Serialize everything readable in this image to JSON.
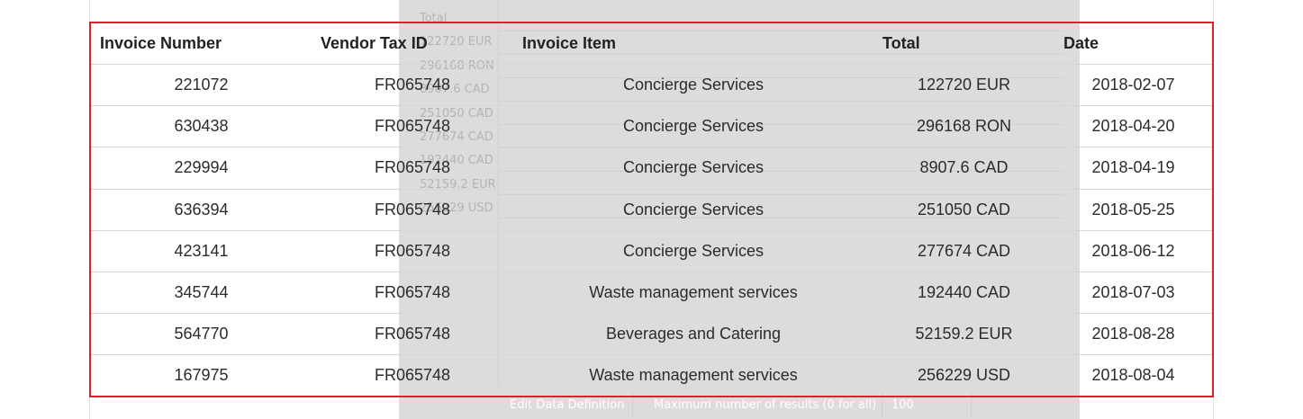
{
  "table": {
    "columns": [
      "Invoice Number",
      "Vendor Tax ID",
      "Invoice Item",
      "Total",
      "Date"
    ],
    "rows": [
      [
        "221072",
        "FR065748",
        "Concierge Services",
        "122720 EUR",
        "2018-02-07"
      ],
      [
        "630438",
        "FR065748",
        "Concierge Services",
        "296168 RON",
        "2018-04-20"
      ],
      [
        "229994",
        "FR065748",
        "Concierge Services",
        "8907.6 CAD",
        "2018-04-19"
      ],
      [
        "636394",
        "FR065748",
        "Concierge Services",
        "251050 CAD",
        "2018-05-25"
      ],
      [
        "423141",
        "FR065748",
        "Concierge Services",
        "277674 CAD",
        "2018-06-12"
      ],
      [
        "345744",
        "FR065748",
        "Waste management services",
        "192440 CAD",
        "2018-07-03"
      ],
      [
        "564770",
        "FR065748",
        "Beverages and Catering",
        "52159.2 EUR",
        "2018-08-28"
      ],
      [
        "167975",
        "FR065748",
        "Waste management services",
        "256229 USD",
        "2018-08-04"
      ]
    ]
  },
  "background_window": {
    "column_header": "Total",
    "values": [
      "122720 EUR",
      "296168 RON",
      "8907.6 CAD",
      "251050 CAD",
      "277674 CAD",
      "192440 CAD",
      "52159.2 EUR",
      "256229 USD"
    ],
    "edit_button_label": "Edit Data Definition",
    "max_results_label": "Maximum number of results (0 for all)",
    "max_results_value": "100"
  },
  "colors": {
    "highlight_border": "#d9232a",
    "overlay": "#dcdcdc",
    "row_divider": "#d6d6d6"
  }
}
